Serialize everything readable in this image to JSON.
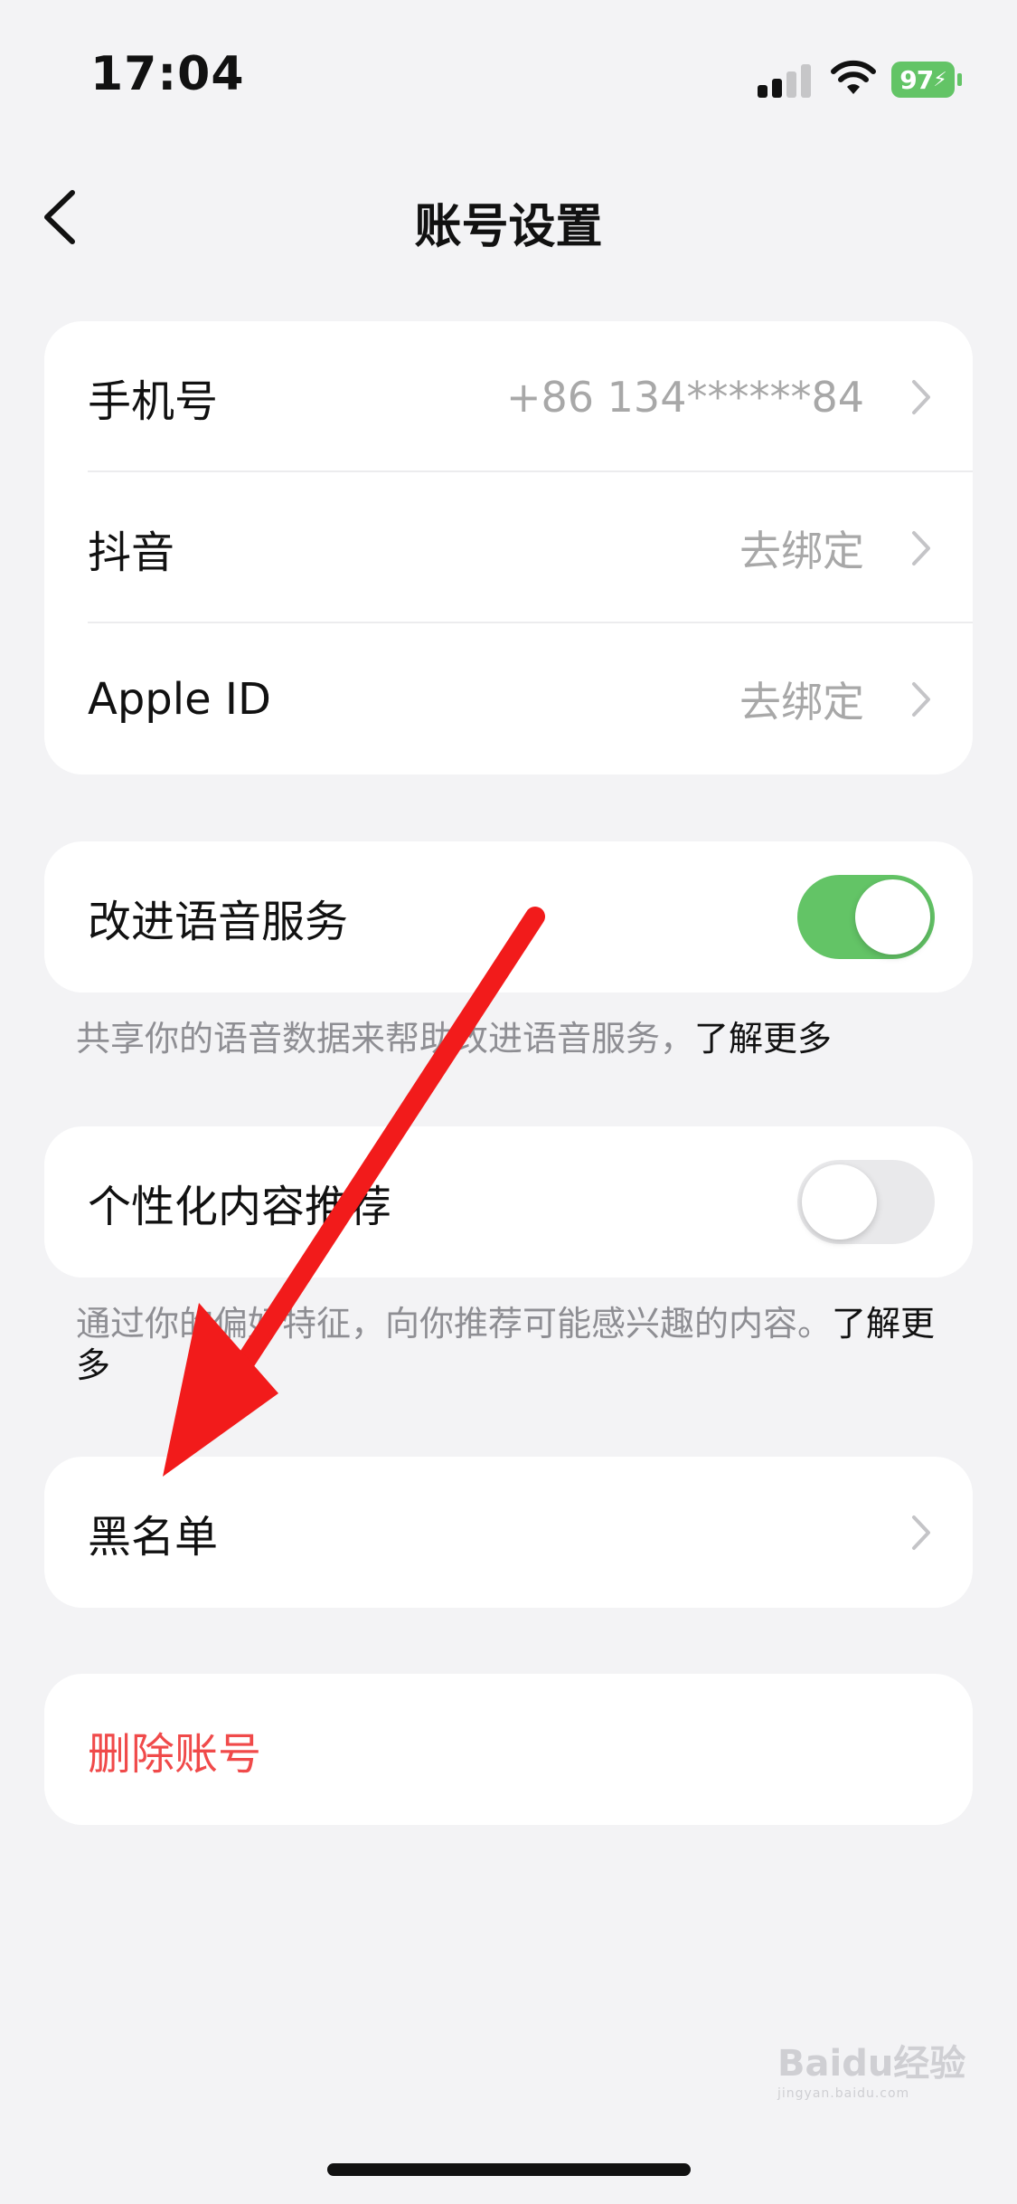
{
  "status_bar": {
    "time": "17:04",
    "battery": "97"
  },
  "nav": {
    "title": "账号设置"
  },
  "account_card": {
    "rows": [
      {
        "label": "手机号",
        "value": "+86 134******84"
      },
      {
        "label": "抖音",
        "value": "去绑定"
      },
      {
        "label": "Apple ID",
        "value": "去绑定"
      }
    ]
  },
  "voice_service": {
    "label": "改进语音服务",
    "enabled": true,
    "footnote": "共享你的语音数据来帮助改进语音服务，",
    "learn_more": "了解更多"
  },
  "personalized": {
    "label": "个性化内容推荐",
    "enabled": false,
    "footnote": "通过你的偏好特征，向你推荐可能感兴趣的内容。",
    "learn_more": "了解更多"
  },
  "blacklist": {
    "label": "黑名单"
  },
  "delete_account": {
    "label": "删除账号",
    "color": "#f04a4a"
  },
  "colors": {
    "toggle_on": "#63c466",
    "annotation_arrow": "#f21b1b",
    "background": "#f3f3f5"
  },
  "watermark": {
    "text": "Baidu经验",
    "sub": "jingyan.baidu.com"
  }
}
